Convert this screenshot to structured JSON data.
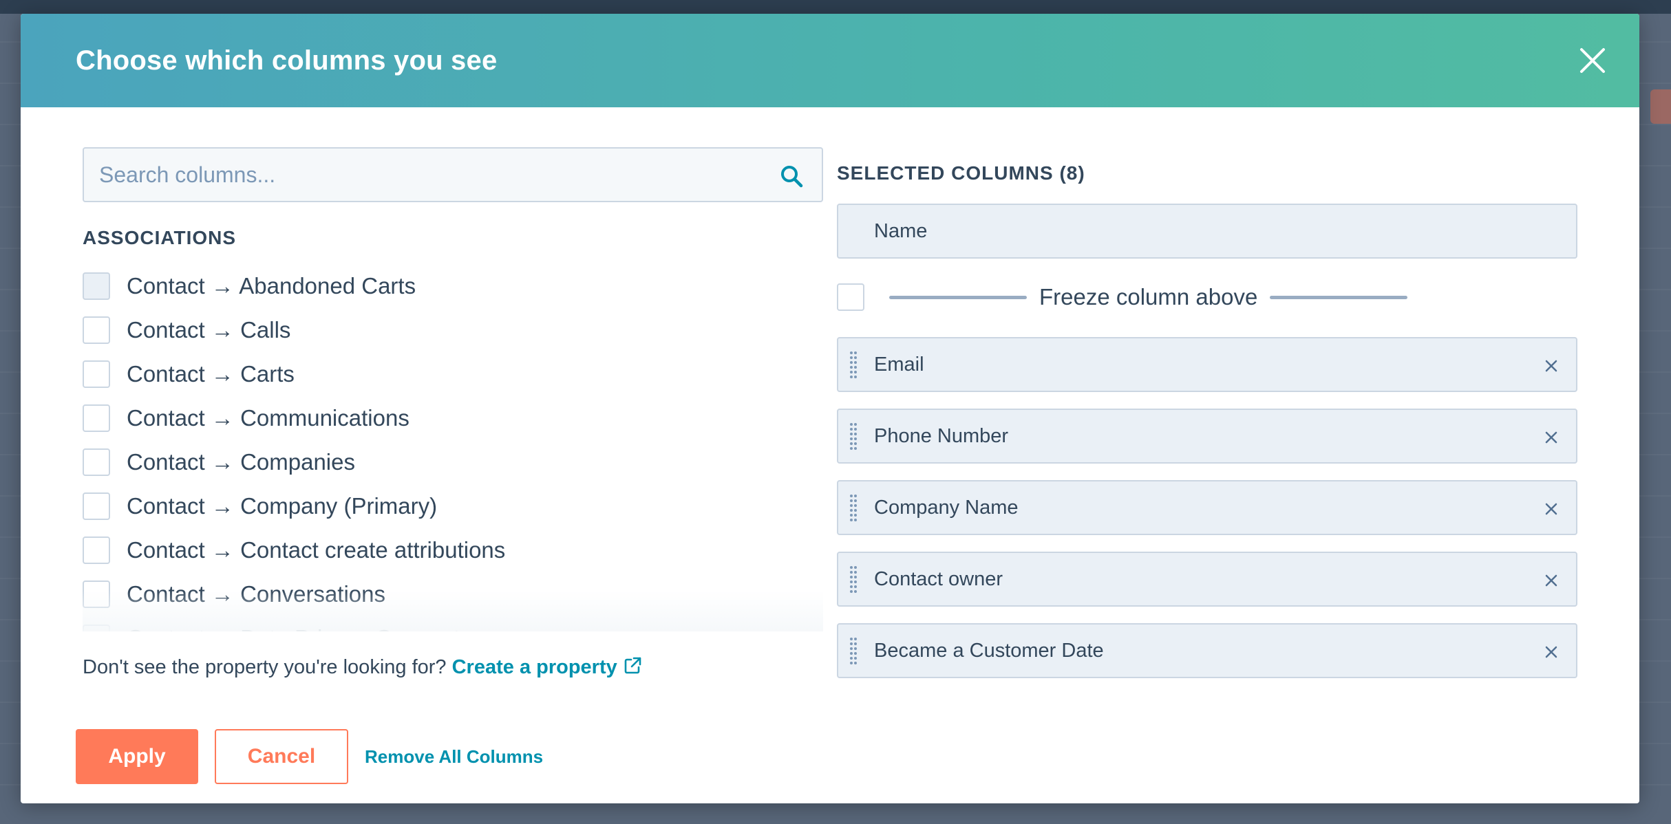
{
  "modal": {
    "title": "Choose which columns you see"
  },
  "search": {
    "placeholder": "Search columns..."
  },
  "associations": {
    "title": "ASSOCIATIONS",
    "items": [
      "Contact → Abandoned Carts",
      "Contact → Calls",
      "Contact → Carts",
      "Contact → Communications",
      "Contact → Companies",
      "Contact → Company (Primary)",
      "Contact → Contact create attributions",
      "Contact → Conversations",
      "Contact → Data Privacy Consents"
    ]
  },
  "footer_note": {
    "text": "Don't see the property you're looking for? ",
    "link": "Create a property"
  },
  "selected": {
    "title": "SELECTED COLUMNS (8)",
    "frozen": "Name",
    "freeze_label": "Freeze column above",
    "columns": [
      "Email",
      "Phone Number",
      "Company Name",
      "Contact owner",
      "Became a Customer Date"
    ]
  },
  "buttons": {
    "apply": "Apply",
    "cancel": "Cancel",
    "remove_all": "Remove All Columns"
  },
  "colors": {
    "accent": "#ff7a59",
    "link": "#0091ae",
    "header_start": "#4ba4bd",
    "header_end": "#52bca2"
  }
}
